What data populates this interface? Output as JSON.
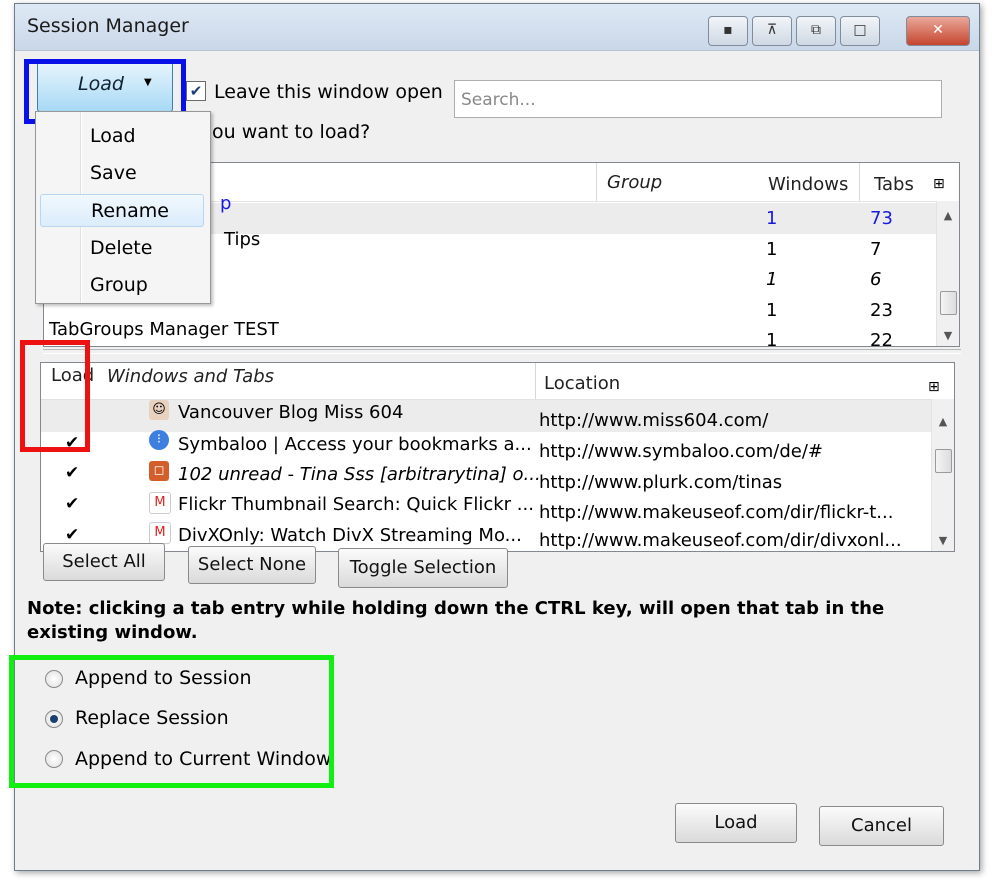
{
  "window": {
    "title": "Session Manager"
  },
  "toolbar": {
    "load_split_label": "Load",
    "leave_open_label": "Leave this window open",
    "search_placeholder": "Search...",
    "prompt_fragment": "ou want to load?"
  },
  "load_menu": {
    "items": [
      {
        "label": "Load"
      },
      {
        "label": "Save"
      },
      {
        "label": "Rename",
        "highlighted": true
      },
      {
        "label": "Delete"
      },
      {
        "label": "Group"
      }
    ]
  },
  "sessions": {
    "columns": {
      "group": "Group",
      "windows": "Windows",
      "tabs": "Tabs"
    },
    "rows": [
      {
        "name": "p",
        "windows": "1",
        "tabs": "73",
        "selected": true
      },
      {
        "name": "Tips",
        "windows": "1",
        "tabs": "7"
      },
      {
        "name": "",
        "windows": "1",
        "tabs": "6"
      },
      {
        "name": "",
        "windows": "1",
        "tabs": "23"
      },
      {
        "name": "TabGroups Manager TEST",
        "windows": "1",
        "tabs": "22"
      }
    ]
  },
  "tabs_tree": {
    "columns": {
      "load": "Load",
      "windows_tabs": "Windows and Tabs",
      "location": "Location"
    },
    "rows": [
      {
        "checked": false,
        "icon": "person-favicon",
        "title": "Vancouver Blog Miss 604",
        "location": "http://www.miss604.com/"
      },
      {
        "checked": true,
        "icon": "symbaloo-favicon",
        "title": "Symbaloo | Access your bookmarks a...",
        "location": "http://www.symbaloo.com/de/#"
      },
      {
        "checked": true,
        "icon": "plurk-favicon",
        "title": "102 unread - Tina Sss [arbitrarytina] o...",
        "location": "http://www.plurk.com/tinas"
      },
      {
        "checked": true,
        "icon": "makeuseof-favicon",
        "title": "Flickr Thumbnail Search: Quick Flickr ...",
        "location": "http://www.makeuseof.com/dir/flickr-t..."
      },
      {
        "checked": true,
        "icon": "makeuseof-favicon",
        "title": "DivXOnly: Watch DivX Streaming Mo...",
        "location": "http://www.makeuseof.com/dir/divxonl..."
      }
    ]
  },
  "selection_buttons": {
    "select_all": "Select All",
    "select_none": "Select None",
    "toggle": "Toggle Selection"
  },
  "note": "Note: clicking a tab entry while holding down the CTRL key, will open that tab in the existing window.",
  "options": [
    {
      "label": "Append to Session",
      "selected": false
    },
    {
      "label": "Replace Session",
      "selected": true
    },
    {
      "label": "Append to Current Window",
      "selected": false
    }
  ],
  "footer": {
    "load": "Load",
    "cancel": "Cancel"
  },
  "colors": {
    "highlight_blue": "#0a10e8",
    "highlight_red": "#ee1111",
    "highlight_green": "#11ee11",
    "link_blue": "#1a1adf"
  }
}
